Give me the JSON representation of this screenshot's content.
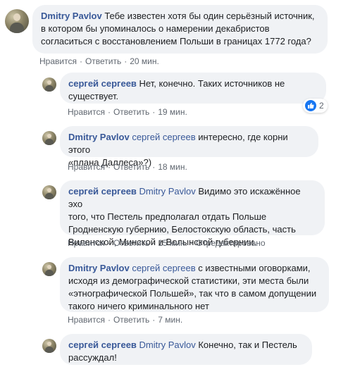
{
  "comments": [
    {
      "author": "Dmitry Pavlov",
      "mention": "",
      "text": " Тебе известен хотя бы один серьёзный источник,\nв котором бы упоминалось о намерении декабристов\nсогласиться с восстановлением Польши в границах 1772 года?",
      "actions": [
        "Нравится",
        "Ответить",
        "20 мин."
      ]
    },
    {
      "author": "сергей сергеев",
      "mention": "",
      "text": " Нет, конечно. Таких источников не\nсуществует.",
      "actions": [
        "Нравится",
        "Ответить",
        "19 мин."
      ],
      "reaction_count": "2",
      "reaction_icon": "thumbs-up-icon"
    },
    {
      "author": "Dmitry Pavlov",
      "mention": "сергей сергеев",
      "text": " интересно, где корни этого\n«плана Даллеса»?)",
      "actions": [
        "Нравится",
        "Ответить",
        "18 мин."
      ]
    },
    {
      "author": "сергей сергеев",
      "mention": "Dmitry Pavlov",
      "text": " Видимо это искажённое эхо\nтого, что Пестель предполагал отдать Польше\nГродненскую губернию, Белостокскую область, часть\nВиленской, Минской и Волынской губернии.",
      "actions": [
        "Нравится",
        "Ответить",
        "15 мин.",
        "Отредактировано"
      ]
    },
    {
      "author": "Dmitry Pavlov",
      "mention": "сергей сергеев",
      "text": " с известными оговорками,\nисходя из демографической статистики, эти места были\n«этнографической Польшей», так что в самом допущении\nтакого ничего криминального нет",
      "actions": [
        "Нравится",
        "Ответить",
        "7 мин."
      ]
    },
    {
      "author": "сергей сергеев",
      "mention": "Dmitry Pavlov",
      "text": " Конечно, так и Пестель\nрассуждал!",
      "actions": []
    }
  ],
  "colors": {
    "bubble_bg": "#f0f2f5",
    "author": "#385898",
    "meta": "#606770",
    "like_blue": "#1877f2"
  }
}
